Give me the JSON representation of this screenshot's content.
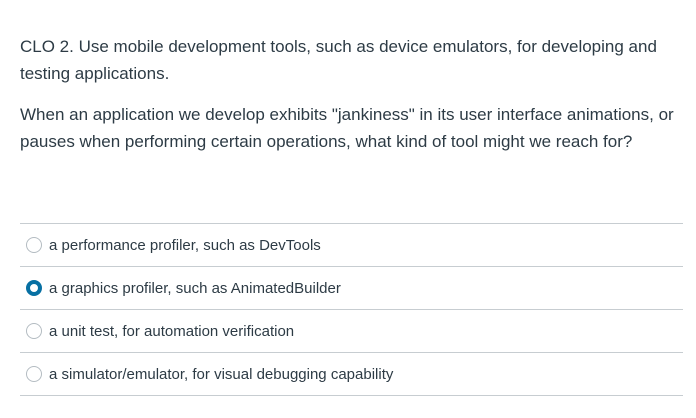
{
  "question": {
    "objective": "CLO 2. Use mobile development tools, such as device emulators, for developing and testing applications.",
    "prompt": "When an application we develop exhibits \"jankiness\" in its user interface animations, or pauses when performing certain operations, what kind of tool might we reach for?"
  },
  "answers": [
    {
      "label": "a performance profiler, such as DevTools",
      "selected": false
    },
    {
      "label": "a graphics profiler, such as AnimatedBuilder",
      "selected": true
    },
    {
      "label": "a unit test, for automation verification",
      "selected": false
    },
    {
      "label": "a simulator/emulator, for visual debugging capability",
      "selected": false
    }
  ],
  "colors": {
    "text": "#2d3b45",
    "divider": "#c7cdd1",
    "radio_selected": "#0770a3",
    "radio_border": "#b4bcc2"
  }
}
